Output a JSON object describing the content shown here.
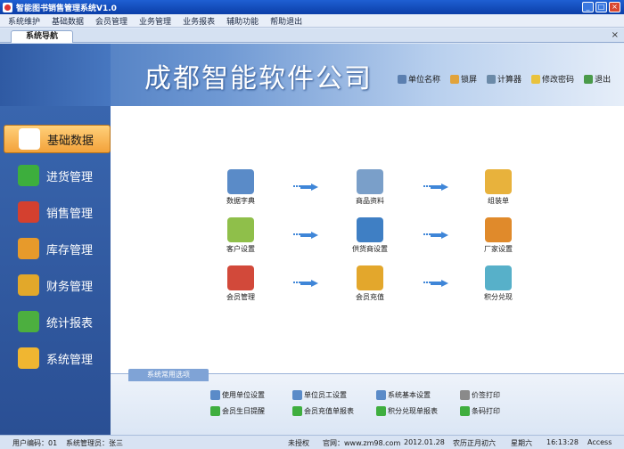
{
  "window": {
    "title": "智能图书销售管理系统V1.0"
  },
  "menu": [
    "系统维护",
    "基础数据",
    "会员管理",
    "业务管理",
    "业务报表",
    "辅助功能",
    "帮助退出"
  ],
  "tab": {
    "label": "系统导航"
  },
  "banner": {
    "company": "成都智能软件公司"
  },
  "quick_links": [
    {
      "label": "单位名称",
      "icon": "user-icon",
      "color": "#5b7fb0"
    },
    {
      "label": "锁屏",
      "icon": "lock-icon",
      "color": "#e1a33b"
    },
    {
      "label": "计算器",
      "icon": "calculator-icon",
      "color": "#6b8aa8"
    },
    {
      "label": "修改密码",
      "icon": "bulb-icon",
      "color": "#e9c23d"
    },
    {
      "label": "退出",
      "icon": "exit-icon",
      "color": "#4a9a4a"
    }
  ],
  "sidebar": [
    {
      "label": "基础数据",
      "icon": "edit-icon",
      "color": "#ffffff",
      "active": true
    },
    {
      "label": "进货管理",
      "icon": "plus-icon",
      "color": "#3dae3d",
      "active": false
    },
    {
      "label": "销售管理",
      "icon": "cube-icon",
      "color": "#d4402f",
      "active": false
    },
    {
      "label": "库存管理",
      "icon": "house-icon",
      "color": "#e79a2b",
      "active": false
    },
    {
      "label": "财务管理",
      "icon": "coins-icon",
      "color": "#e2a82a",
      "active": false
    },
    {
      "label": "统计报表",
      "icon": "chart-icon",
      "color": "#4caf3f",
      "active": false
    },
    {
      "label": "系统管理",
      "icon": "gear-icon",
      "color": "#f0b631",
      "active": false
    }
  ],
  "grid": [
    {
      "label": "数据字典",
      "icon": "edit-icon",
      "color": "#5a8bc8"
    },
    {
      "label": "商品资料",
      "icon": "form-icon",
      "color": "#7a9fc9"
    },
    {
      "label": "组装单",
      "icon": "folder-add-icon",
      "color": "#e8b23c"
    },
    {
      "label": "客户设置",
      "icon": "users-icon",
      "color": "#8fbf4a"
    },
    {
      "label": "供货商设置",
      "icon": "people-icon",
      "color": "#3f7fc4"
    },
    {
      "label": "厂家设置",
      "icon": "house-icon",
      "color": "#e08a2b"
    },
    {
      "label": "会员管理",
      "icon": "members-icon",
      "color": "#d2493a"
    },
    {
      "label": "会员充值",
      "icon": "coins-icon",
      "color": "#e3a72c"
    },
    {
      "label": "积分兑现",
      "icon": "gift-icon",
      "color": "#57b0c9"
    }
  ],
  "bottom": {
    "tab_label": "系统常用选项",
    "tools": [
      {
        "label": "使用单位设置",
        "icon": "settings-icon",
        "color": "#5a8bc8"
      },
      {
        "label": "单位员工设置",
        "icon": "settings-icon",
        "color": "#5a8bc8"
      },
      {
        "label": "系统基本设置",
        "icon": "settings-icon",
        "color": "#5a8bc8"
      },
      {
        "label": "价签打印",
        "icon": "print-icon",
        "color": "#8a8a8a"
      },
      {
        "label": "会员生日提醒",
        "icon": "add-icon",
        "color": "#3fae3f"
      },
      {
        "label": "会员充值单报表",
        "icon": "add-icon",
        "color": "#3fae3f"
      },
      {
        "label": "积分兑现单报表",
        "icon": "add-icon",
        "color": "#3fae3f"
      },
      {
        "label": "条码打印",
        "icon": "add-icon",
        "color": "#3fae3f"
      }
    ]
  },
  "status": {
    "user_code": "用户编码：01",
    "admin": "系统管理员：张三",
    "license": "未授权",
    "website": "官网：www.zm98.com",
    "date": "2012.01.28",
    "lunar": "农历正月初六",
    "weekday": "星期六",
    "time": "16:13:28",
    "db": "Access"
  }
}
